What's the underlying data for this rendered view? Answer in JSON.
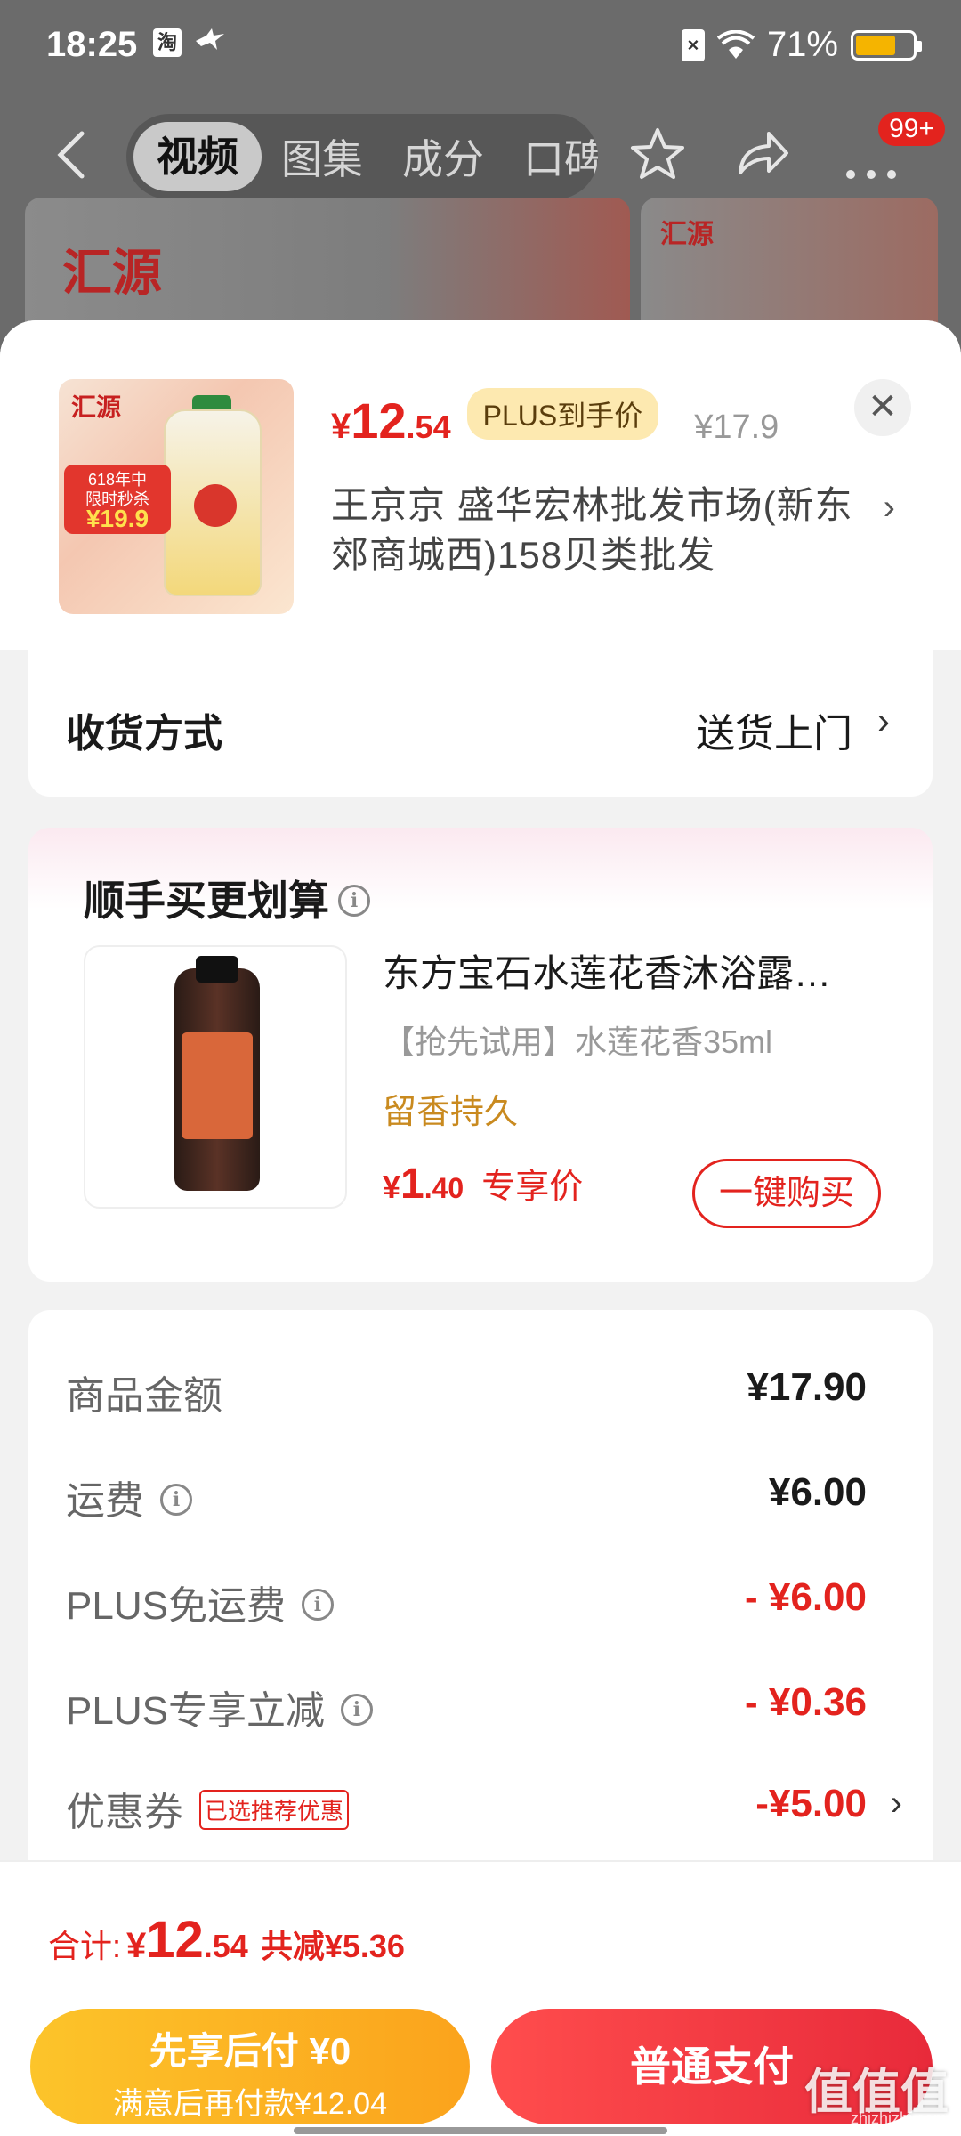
{
  "status_bar": {
    "time": "18:25",
    "app_glyph": "淘",
    "battery": "71%",
    "battery_level": 0.71,
    "icons": [
      "taobao-icon",
      "bird-icon",
      "sim-icon",
      "wifi-icon",
      "battery-icon"
    ]
  },
  "nav": {
    "tabs": [
      {
        "label": "视频",
        "active": true
      },
      {
        "label": "图集",
        "active": false
      },
      {
        "label": "成分",
        "active": false
      },
      {
        "label": "口碑",
        "active": false
      }
    ],
    "badge": "99+",
    "icons": [
      "back-icon",
      "star-icon",
      "share-icon",
      "more-icon"
    ]
  },
  "background": {
    "logo_text": "汇源"
  },
  "product": {
    "price_symbol": "¥",
    "price_int": "12",
    "price_dec": ".54",
    "plus_tag": "PLUS到手价",
    "original_price": "¥17.9",
    "close_glyph": "✕",
    "shop_name": "王京京  盛华宏林批发市场(新东郊商城西)158贝类批发",
    "chevron": "›",
    "thumb": {
      "logo": "汇源",
      "tag_line1": "618年中",
      "tag_line2": "限时秒杀",
      "tag_price": "¥19.9"
    }
  },
  "delivery": {
    "label": "收货方式",
    "value": "送货上门",
    "chevron": "›"
  },
  "upsell": {
    "title": "顺手买更划算",
    "info_glyph": "i",
    "item": {
      "name": "东方宝石水莲花香沐浴露…",
      "desc": "【抢先试用】水莲花香35ml",
      "tag": "留香持久",
      "price_symbol": "¥",
      "price_int": "1",
      "price_dec": ".40",
      "price_label": "专享价",
      "button": "一键购买"
    }
  },
  "summary": {
    "rows": [
      {
        "label": "商品金额",
        "value": "¥17.90",
        "info": false,
        "red": false
      },
      {
        "label": "运费",
        "value": "¥6.00",
        "info": true,
        "red": false
      },
      {
        "label": "PLUS免运费",
        "value": "- ¥6.00",
        "info": true,
        "red": true
      },
      {
        "label": "PLUS专享立减",
        "value": "- ¥0.36",
        "info": true,
        "red": true
      },
      {
        "label": "优惠券",
        "value": "-¥5.00",
        "info": false,
        "red": true,
        "badge": "已选推荐优惠",
        "chevron": "›"
      }
    ]
  },
  "bottom": {
    "total_label": "合计:",
    "price_symbol": "¥",
    "total_int": "12",
    "total_dec": ".54",
    "saved": "共减¥5.36",
    "pay_later_title": "先享后付 ¥0",
    "pay_later_sub": "满意后再付款¥12.04",
    "pay_normal": "普通支付"
  },
  "watermark": {
    "text": "值值值",
    "url": "zhizhizhi.com"
  },
  "colors": {
    "accent_red": "#e3231e",
    "gold": "#fba31c",
    "plus_tag_bg": "#fde9b0"
  }
}
